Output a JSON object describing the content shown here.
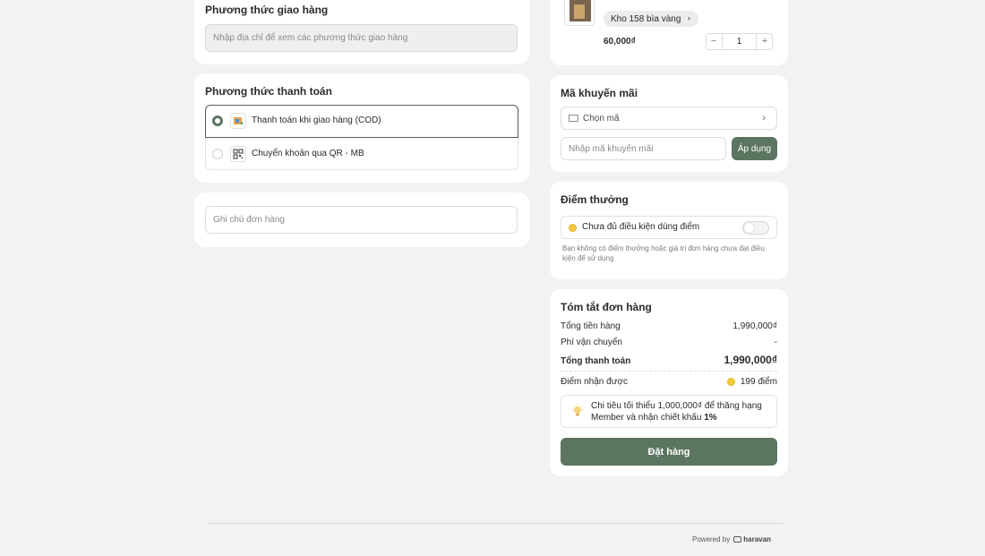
{
  "shipping": {
    "title": "Phương thức giao hàng",
    "address_placeholder": "Nhập địa chỉ để xem các phương thức giao hàng"
  },
  "payment": {
    "title": "Phương thức thanh toán",
    "options": [
      {
        "label": "Thanh toán khi giao hàng (COD)",
        "selected": true,
        "icon": "cod-icon"
      },
      {
        "label": "Chuyển khoản qua QR - MB",
        "selected": false,
        "icon": "qr-code-icon"
      }
    ]
  },
  "note": {
    "placeholder": "Ghi chú đơn hàng"
  },
  "product": {
    "variant": "Kho 158 bìa vàng",
    "price": "60,000₫",
    "quantity": "1",
    "minus": "−",
    "plus": "+"
  },
  "promo": {
    "title": "Mã khuyến mãi",
    "select_label": "Chọn mã",
    "input_placeholder": "Nhập mã khuyến mãi",
    "apply_label": "Áp dụng"
  },
  "points": {
    "title": "Điểm thưởng",
    "status": "Chưa đủ điều kiện dùng điểm",
    "toggle_on": false,
    "note": "Bạn không có điểm thưởng hoặc giá trị đơn hàng chưa đạt điều kiện để sử dụng"
  },
  "summary": {
    "title": "Tóm tắt đơn hàng",
    "subtotal_label": "Tổng tiền hàng",
    "subtotal_value": "1,990,000₫",
    "shipping_label": "Phí vận chuyển",
    "shipping_value": "-",
    "total_label": "Tổng thanh toán",
    "total_value": "1,990,000₫",
    "earned_label": "Điểm nhận được",
    "earned_value": "199 điểm",
    "tip_text": "Chi tiêu tối thiểu 1,000,000₫ để thăng hạng Member và nhận chiết khấu ",
    "tip_bold": "1%",
    "order_button": "Đặt hàng"
  },
  "footer": {
    "powered_by": "Powered by",
    "brand": "haravan"
  },
  "colors": {
    "accent": "#5c7560",
    "background": "#f2f2f2",
    "card": "#ffffff"
  }
}
